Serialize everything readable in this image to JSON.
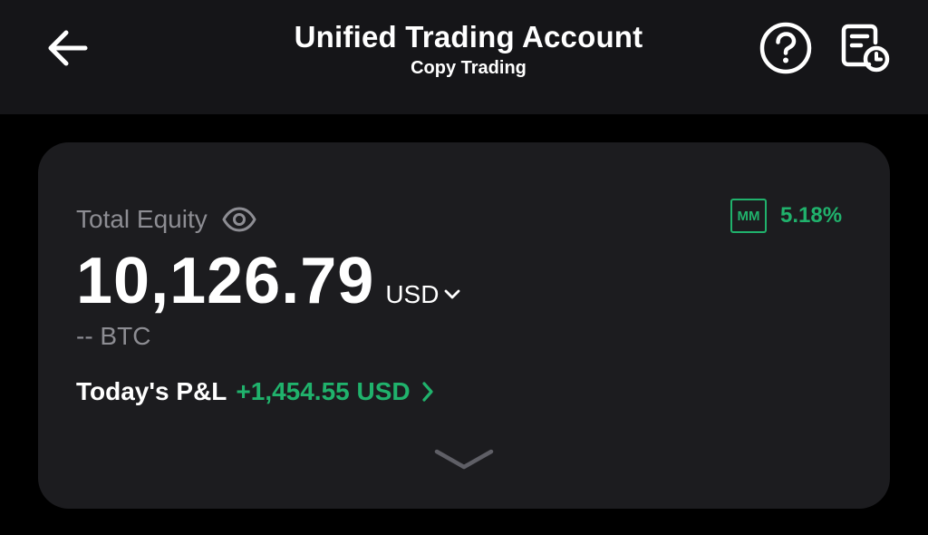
{
  "header": {
    "title": "Unified Trading Account",
    "subtitle": "Copy Trading"
  },
  "icons": {
    "back": "arrow-left-icon",
    "help": "question-circle-icon",
    "report": "document-clock-icon",
    "visibility": "eye-icon",
    "currency_dropdown": "chevron-down-icon",
    "pnl_detail": "chevron-right-icon",
    "expand": "chevron-down-icon"
  },
  "card": {
    "equity_label": "Total Equity",
    "mm_badge": "MM",
    "mm_value": "5.18%",
    "amount": "10,126.79",
    "currency": "USD",
    "btc_value": "-- BTC",
    "pnl_label": "Today's P&L",
    "pnl_value": "+1,454.55 USD"
  },
  "colors": {
    "background": "#000000",
    "header_bg": "#151518",
    "card_bg": "#1c1c1f",
    "positive": "#20b26c",
    "muted_text": "#8d8d93"
  }
}
